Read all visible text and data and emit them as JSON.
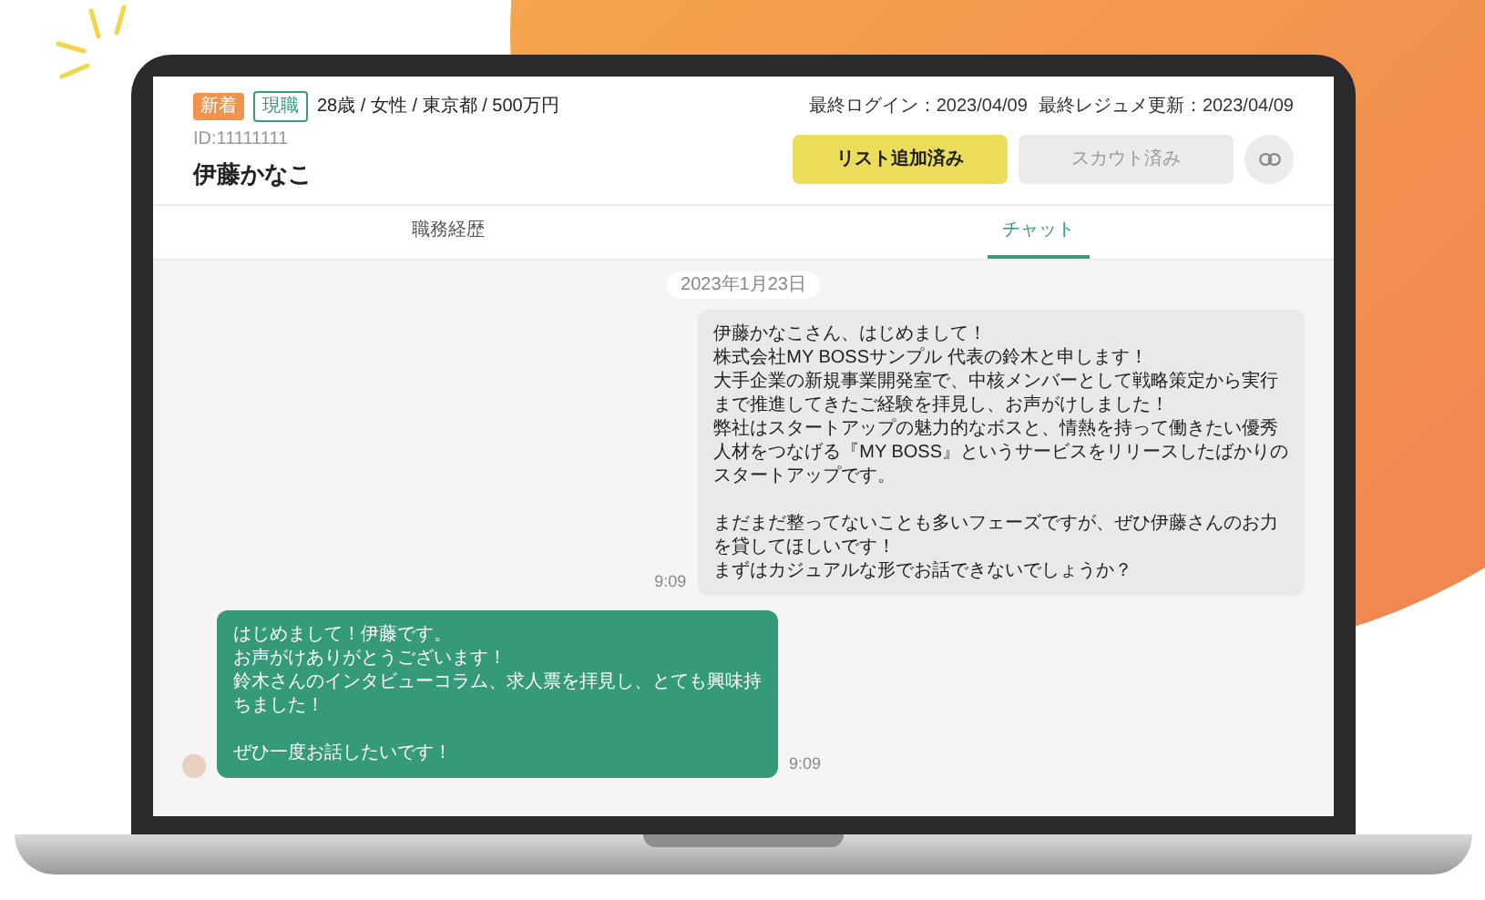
{
  "profile": {
    "badges": [
      {
        "text": "新着",
        "kind": "filled"
      },
      {
        "text": "現職",
        "kind": "outline"
      }
    ],
    "summary": "28歳 / 女性 / 東京都 / 500万円",
    "last_login": "最終ログイン：2023/04/09",
    "last_resume_update": "最終レジュメ更新：2023/04/09",
    "id": "ID:11111111",
    "name": "伊藤かなこ"
  },
  "actions": [
    {
      "label": "リスト追加済み",
      "kind": "primary"
    },
    {
      "label": "スカウト済み",
      "kind": "secondary"
    },
    {
      "kind": "link"
    }
  ],
  "tabs": [
    {
      "label": "職務経歴",
      "selected": false
    },
    {
      "label": "チャット",
      "selected": true
    }
  ],
  "chat": {
    "date": "2023年1月23日",
    "messages": [
      {
        "kind": "received",
        "time": "9:09",
        "paragraphs": [
          [
            "伊藤かなこさん、はじめまして！",
            "株式会社MY BOSSサンプル 代表の鈴木と申します！",
            "大手企業の新規事業開発室で、中核メンバーとして戦略策定から実行",
            "まで推進してきたご経験を拝見し、お声がけしました！",
            "弊社はスタートアップの魅力的なボスと、情熱を持って働きたい優秀",
            "人材をつなげる『MY BOSS』というサービスをリリースしたばかりの",
            "スタートアップです。"
          ],
          [
            "まだまだ整ってないことも多いフェーズですが、ぜひ伊藤さんのお力",
            "を貸してほしいです！",
            "まずはカジュアルな形でお話できないでしょうか？"
          ]
        ]
      },
      {
        "kind": "sent",
        "time": "9:09",
        "paragraphs": [
          [
            "はじめまして！伊藤です。",
            "お声がけありがとうございます！",
            "鈴木さんのインタビューコラム、求人票を拝見し、とても興味持",
            "ちました！"
          ],
          [
            "ぜひ一度お話したいです！"
          ]
        ]
      }
    ]
  }
}
